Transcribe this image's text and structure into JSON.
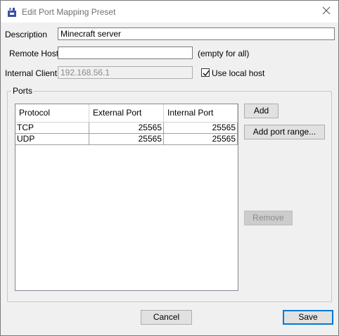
{
  "window": {
    "title": "Edit Port Mapping Preset"
  },
  "form": {
    "description_label": "Description",
    "description_value": "Minecraft server",
    "remote_host_label": "Remote Host",
    "remote_host_value": "",
    "remote_host_hint": "(empty for all)",
    "internal_client_label": "Internal Client",
    "internal_client_value": "192.168.56.1",
    "use_local_host_label": "Use local host",
    "use_local_host_checked": true
  },
  "ports": {
    "group_title": "Ports",
    "columns": [
      "Protocol",
      "External Port",
      "Internal Port"
    ],
    "rows": [
      {
        "protocol": "TCP",
        "external": "25565",
        "internal": "25565"
      },
      {
        "protocol": "UDP",
        "external": "25565",
        "internal": "25565"
      }
    ],
    "add_label": "Add",
    "add_range_label": "Add port range...",
    "remove_label": "Remove"
  },
  "footer": {
    "cancel_label": "Cancel",
    "save_label": "Save"
  },
  "colors": {
    "accent": "#0078d7",
    "icon_primary": "#3d4fa3",
    "icon_secondary": "#8a93c9"
  }
}
